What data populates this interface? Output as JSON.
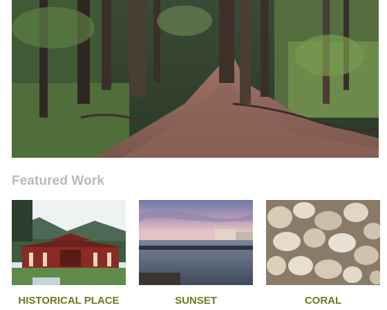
{
  "hero": {
    "image": "jungle-trail-photo"
  },
  "featured": {
    "heading": "Featured Work",
    "items": [
      {
        "caption": "HISTORICAL PLACE",
        "image": "temple-photo"
      },
      {
        "caption": "SUNSET",
        "image": "sunset-photo"
      },
      {
        "caption": "CORAL",
        "image": "coral-photo"
      }
    ]
  },
  "colors": {
    "heading": "#b9b9b9",
    "caption": "#6b7a1e"
  }
}
